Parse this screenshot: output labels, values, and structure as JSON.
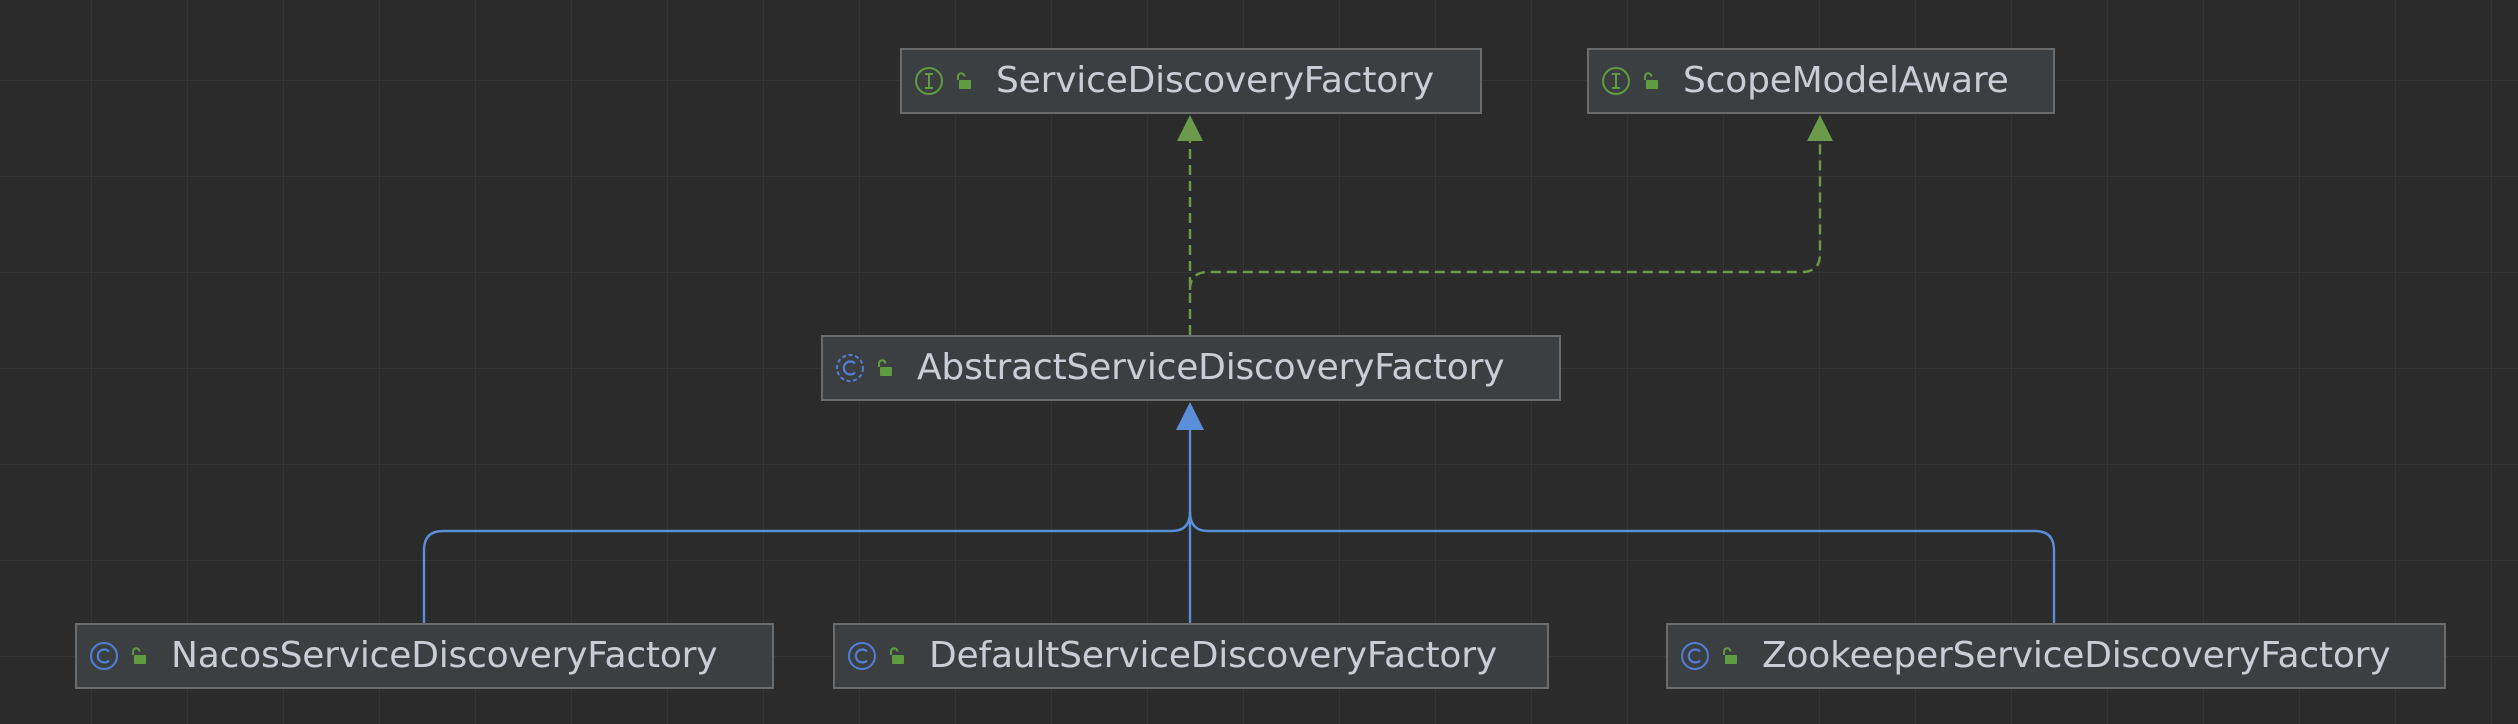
{
  "diagram": {
    "colors": {
      "background": "#2b2b2b",
      "grid": "#353535",
      "node_fill": "#3c3f41",
      "node_border": "#6b6b6b",
      "label": "#c9ced6",
      "implements_edge": "#6a9a4a",
      "extends_edge": "#5b8fd9",
      "interface_icon": "#5e9c3f",
      "class_icon": "#4f7fd6",
      "lock_icon": "#5e9c3f"
    },
    "nodes": [
      {
        "id": "service-discovery-factory",
        "label": "ServiceDiscoveryFactory",
        "kind": "interface-icon",
        "access": "public-lock-icon"
      },
      {
        "id": "scope-model-aware",
        "label": "ScopeModelAware",
        "kind": "interface-icon",
        "access": "public-lock-icon"
      },
      {
        "id": "abstract-service-discovery-factory",
        "label": "AbstractServiceDiscoveryFactory",
        "kind": "abstract-class-icon",
        "access": "public-lock-icon"
      },
      {
        "id": "nacos-service-discovery-factory",
        "label": "NacosServiceDiscoveryFactory",
        "kind": "class-icon",
        "access": "public-lock-icon"
      },
      {
        "id": "default-service-discovery-factory",
        "label": "DefaultServiceDiscoveryFactory",
        "kind": "class-icon",
        "access": "public-lock-icon"
      },
      {
        "id": "zookeeper-service-discovery-factory",
        "label": "ZookeeperServiceDiscoveryFactory",
        "kind": "class-icon",
        "access": "public-lock-icon"
      }
    ],
    "edges": [
      {
        "from": "abstract-service-discovery-factory",
        "to": "service-discovery-factory",
        "type": "implements"
      },
      {
        "from": "abstract-service-discovery-factory",
        "to": "scope-model-aware",
        "type": "implements"
      },
      {
        "from": "nacos-service-discovery-factory",
        "to": "abstract-service-discovery-factory",
        "type": "extends"
      },
      {
        "from": "default-service-discovery-factory",
        "to": "abstract-service-discovery-factory",
        "type": "extends"
      },
      {
        "from": "zookeeper-service-discovery-factory",
        "to": "abstract-service-discovery-factory",
        "type": "extends"
      }
    ]
  }
}
